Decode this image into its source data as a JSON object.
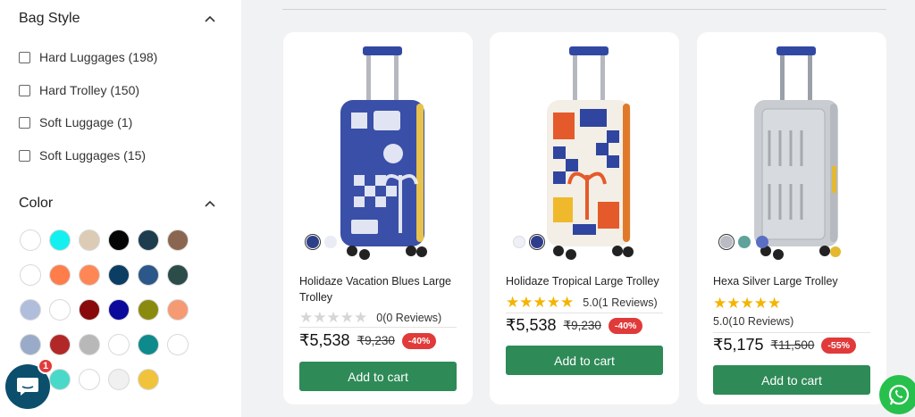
{
  "filters": {
    "bag_style": {
      "title": "Bag Style",
      "options": [
        {
          "label": "Hard Luggages (198)"
        },
        {
          "label": "Hard Trolley (150)"
        },
        {
          "label": "Soft Luggage (1)"
        },
        {
          "label": "Soft Luggages (15)"
        }
      ]
    },
    "color": {
      "title": "Color",
      "swatches": [
        "#ffffff",
        "#14f0f0",
        "#dcccb5",
        "#050505",
        "#1d3c4e",
        "#8a6650",
        "#ffffff",
        "#ff7d4a",
        "#ff8756",
        "#0c3d63",
        "#2c5789",
        "#2c4c4a",
        "#b0bedb",
        "#ffffff",
        "#880a0a",
        "#0b0a9a",
        "#8a8a0e",
        "#f59a73",
        "#9aabc9",
        "#b22828",
        "#b8b8b8",
        "#ffffff",
        "#0f8a8c",
        "#ffffff",
        "#ffffff",
        "#49d9c8",
        "#ffffff",
        "#f0f0f0",
        "#f1c33c"
      ]
    }
  },
  "chat": {
    "badge": "1"
  },
  "products": [
    {
      "name": "Holidaze Vacation Blues Large Trolley",
      "rating_text": "0(0 Reviews)",
      "stars_filled": 0,
      "price": "₹5,538",
      "mrp": "₹9,230",
      "discount": "-40%",
      "cta": "Add to cart",
      "variants": [
        "#2e3f8a",
        "#e9ecf5"
      ]
    },
    {
      "name": "Holidaze Tropical Large Trolley",
      "rating_text": "5.0(1 Reviews)",
      "stars_filled": 5,
      "price": "₹5,538",
      "mrp": "₹9,230",
      "discount": "-40%",
      "cta": "Add to cart",
      "variants": [
        "#eef0f7",
        "#2f3e8c"
      ]
    },
    {
      "name": "Hexa Silver Large Trolley",
      "rating_text": "5.0(10 Reviews)",
      "stars_filled": 5,
      "price": "₹5,175",
      "mrp": "₹11,500",
      "discount": "-55%",
      "cta": "Add to cart",
      "variants": [
        "#b9bcc2",
        "#5fa39a",
        "#5a6fc4"
      ]
    }
  ],
  "colors": {
    "accent": "#2e8a57",
    "star": "#f4b400",
    "discount": "#e03a3a"
  }
}
